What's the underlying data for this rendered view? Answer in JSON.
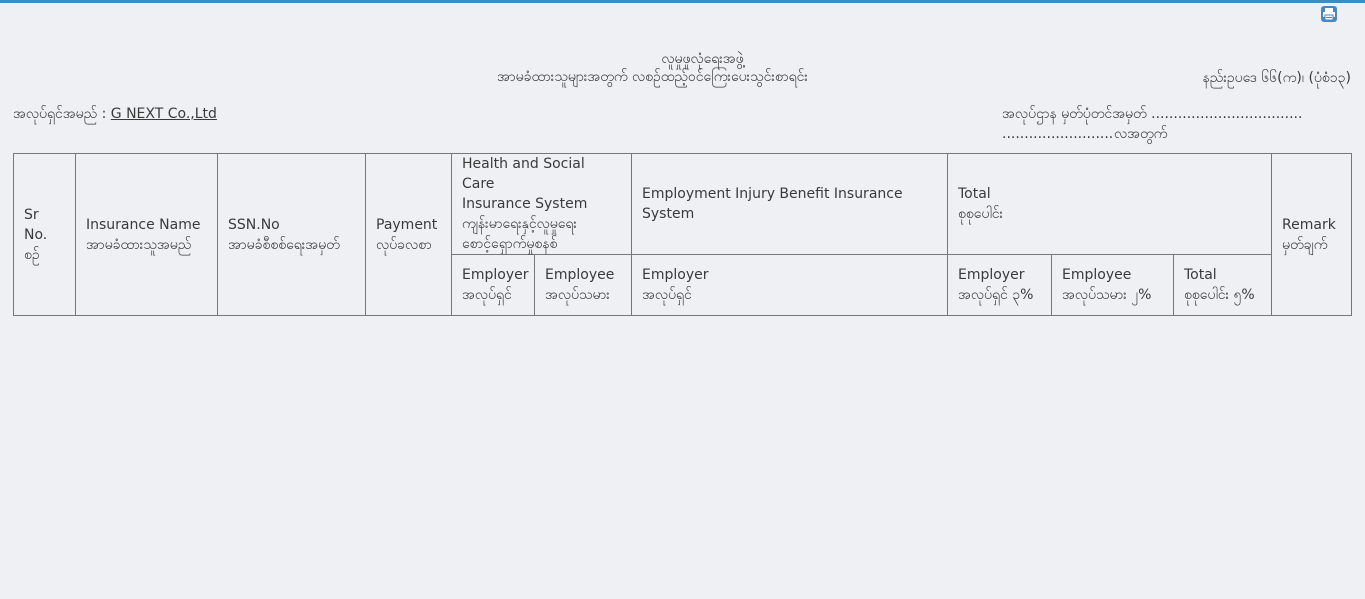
{
  "header": {
    "title_line1": "လူမှုဖူလုံရေးအဖွဲ့",
    "title_line2": "အာမခံထားသူများအတွက် လစဉ်ထည့်ဝင်ကြေးပေးသွင်းစာရင်း",
    "regulation": "နည်းဥပဒေ ၆၆(က)၊ (ပုံစံ၁၃)",
    "employer_label": "အလုပ်ရှင်အမည် :",
    "employer_name": "G NEXT Co.,Ltd",
    "registration_label": "အလုပ်ဌာန မှတ်ပုံတင်အမှတ်",
    "registration_dots": "............................................................",
    "month_dots": "...........................................................",
    "month_label": "လအတွက်"
  },
  "icons": {
    "print": "printer-icon",
    "accent_color": "#4a86c5"
  },
  "table": {
    "sr_no": {
      "en": "Sr No.",
      "mm": "စဉ်"
    },
    "insurance_name": {
      "en": "Insurance Name",
      "mm": "အာမခံထားသူအမည်"
    },
    "ssn_no": {
      "en": "SSN.No",
      "mm": "အာမခံစီစစ်ရေးအမှတ်"
    },
    "payment": {
      "en": "Payment",
      "mm": "လုပ်ခလစာ"
    },
    "health": {
      "en_line1": "Health and Social Care",
      "en_line2": "Insurance System",
      "mm_line1": "ကျန်းမာရေးနှင့်လူမှုရေး",
      "mm_line2": "စောင့်ရှောက်မှုစနစ်"
    },
    "injury": {
      "en": "Employment Injury Benefit Insurance System"
    },
    "total": {
      "en": "Total",
      "mm": "စုစုပေါင်း"
    },
    "remark": {
      "en": "Remark",
      "mm": "မှတ်ချက်"
    },
    "sub": {
      "health_employer": {
        "en": "Employer",
        "mm": "အလုပ်ရှင်"
      },
      "health_employee": {
        "en": "Employee",
        "mm": "အလုပ်သမား"
      },
      "injury_employer": {
        "en": "Employer",
        "mm": "အလုပ်ရှင်"
      },
      "total_employer": {
        "en": "Employer",
        "mm": "အလုပ်ရှင် ၃%"
      },
      "total_employee": {
        "en": "Employee",
        "mm": "အလုပ်သမား ၂%"
      },
      "total_total": {
        "en": "Total",
        "mm": "စုစုပေါင်း ၅%"
      }
    }
  }
}
